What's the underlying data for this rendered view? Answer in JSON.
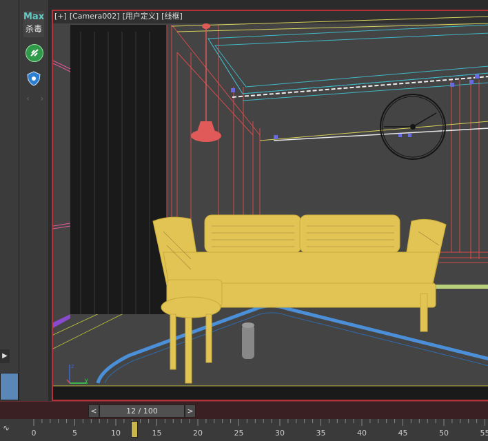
{
  "viewport": {
    "labels": [
      "[+]",
      "[Camera002]",
      "[用户定义]",
      "[线框]"
    ]
  },
  "toolstrip": {
    "logo_line1": "Max",
    "logo_line2": "杀毒"
  },
  "timebar": {
    "frame_display": "12 / 100",
    "prev_label": "<",
    "next_label": ">"
  },
  "timeline": {
    "ticks": [
      "0",
      "5",
      "10",
      "15",
      "20",
      "25",
      "30",
      "35",
      "40",
      "45",
      "50",
      "55"
    ],
    "current_frame": 12
  },
  "colors": {
    "viewport_border": "#b8303a",
    "sofa": "#e2c455",
    "lamp": "#e05a5a",
    "cyan_ceiling": "#3fb7c7",
    "rug_edge": "#4a8fd8"
  }
}
